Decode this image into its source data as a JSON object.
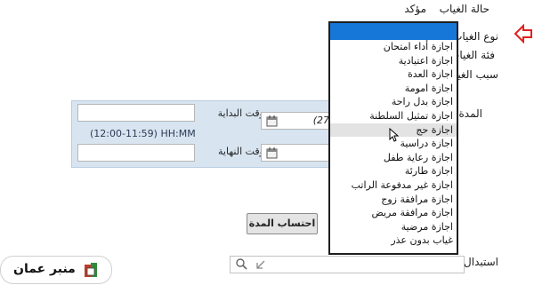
{
  "form": {
    "absence_status_label": "حالة الغياب",
    "absence_status_value": "مؤكد",
    "absence_type_label": "نوع الغياب",
    "absence_category_label": "فئة الغياب",
    "absence_reason_label": "سبب الغياب",
    "duration_label": "المدة",
    "start_time_label": "وقت البداية",
    "end_time_label": "وقت النهاية",
    "time_format_hint": "(12:00-11:59) HH:MM",
    "start_date_partial": "(27",
    "calculate_button": "احتساب المدة",
    "replacement_label": "استبدال بـ"
  },
  "dropdown": {
    "items": [
      "اجازة أداء امتحان",
      "اجازة اعتيادية",
      "اجازة العدة",
      "اجازة امومة",
      "اجازة بدل راحة",
      "اجازة تمثيل السلطنة",
      "اجازة حج",
      "اجازة دراسية",
      "اجازة رعاية طفل",
      "اجازة طارئة",
      "اجازة غير مدفوعة الراتب",
      "اجازة مرافقة زوج",
      "اجازة مرافقة مريض",
      "اجازة مرضية",
      "غياب بدون عذر"
    ],
    "highlight_color": "#1777d9",
    "hover_item": "اجازة حج"
  },
  "watermark": {
    "text": "منبر عمان"
  },
  "icons": {
    "pointer_arrow": "red-arrow-icon",
    "calendar": "calendar-icon",
    "search": "search-icon"
  }
}
